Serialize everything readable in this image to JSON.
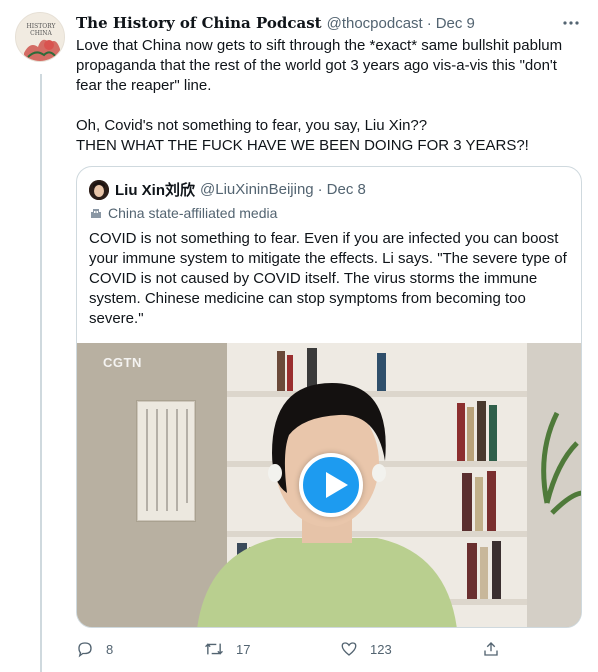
{
  "tweet": {
    "author_name": "The History of China Podcast",
    "handle": "@thocpodcast",
    "separator": "·",
    "date": "Dec 9",
    "avatar_text": [
      "HISTORY",
      "CHINA"
    ],
    "lines": [
      "Love that China now gets to sift through the *exact* same bullshit pablum propaganda that the rest of the world got 3 years ago vis-a-vis this \"don't fear the reaper\" line.",
      "Oh, Covid's not something to fear, you say, Liu Xin??",
      "THEN WHAT THE FUCK HAVE WE BEEN DOING FOR 3 YEARS?!"
    ]
  },
  "quote": {
    "author_name": "Liu Xin刘欣",
    "handle": "@LiuXininBeijing",
    "separator": "·",
    "date": "Dec 8",
    "label": "China state-affiliated media",
    "text": "COVID is not something to fear. Even if you are infected you can boost your immune system to mitigate the effects. Li says. \"The severe type of COVID is not caused by COVID itself. The virus storms the immune system. Chinese medicine can stop symptoms from becoming too severe.\"",
    "video_watermark": "CGTN"
  },
  "actions": {
    "replies": "8",
    "retweets": "17",
    "likes": "123"
  },
  "colors": {
    "accent": "#1d9bf0",
    "secondary_text": "#536471",
    "border": "#cfd9de"
  },
  "icons": [
    "more-icon",
    "reply-icon",
    "retweet-icon",
    "like-icon",
    "share-icon",
    "government-building-icon",
    "play-icon"
  ]
}
